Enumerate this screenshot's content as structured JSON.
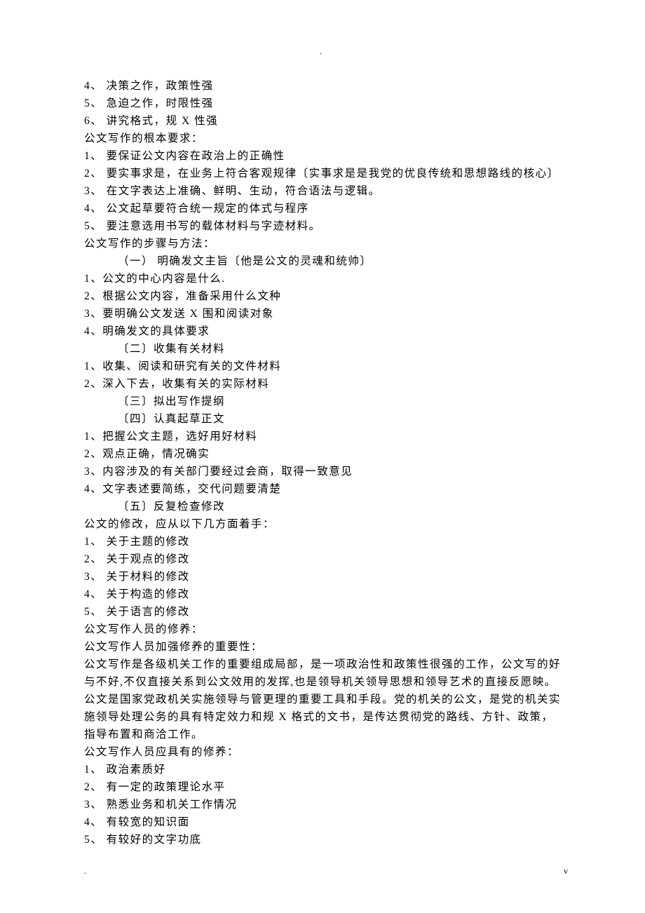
{
  "topMark": ".",
  "lines": [
    {
      "text": "4、 决策之作，政策性强",
      "indent": 0
    },
    {
      "text": "5、 急迫之作，时限性强",
      "indent": 0
    },
    {
      "text": "6、 讲究格式，规 X 性强",
      "indent": 0
    },
    {
      "text": "公文写作的根本要求：",
      "indent": 0
    },
    {
      "text": "1、 要保证公文内容在政治上的正确性",
      "indent": 0
    },
    {
      "text": "2、 要实事求是，在业务上符合客观规律〔实事求是是我党的优良传统和思想路线的核心〕",
      "indent": 0
    },
    {
      "text": "3、 在文字表达上准确、鲜明、生动，符合语法与逻辑。",
      "indent": 0
    },
    {
      "text": "4、 公文起草要符合统一规定的体式与程序",
      "indent": 0
    },
    {
      "text": "5、 要注意选用书写的载体材料与字迹材料。",
      "indent": 0
    },
    {
      "text": "公文写作的步骤与方法：",
      "indent": 0
    },
    {
      "text": "（一） 明确发文主旨〔他是公文的灵魂和统帅〕",
      "indent": 1
    },
    {
      "text": "1、公文的中心内容是什么.",
      "indent": 0
    },
    {
      "text": "2、根据公文内容，准备采用什么文种",
      "indent": 0
    },
    {
      "text": "3、要明确公文发送 X 围和阅读对象",
      "indent": 0
    },
    {
      "text": "4、明确发文的具体要求",
      "indent": 0
    },
    {
      "text": "〔二〕收集有关材料",
      "indent": 1
    },
    {
      "text": "1、收集、阅读和研究有关的文件材料",
      "indent": 0
    },
    {
      "text": "2、深入下去，收集有关的实际材料",
      "indent": 0
    },
    {
      "text": "〔三〕拟出写作提纲",
      "indent": 1
    },
    {
      "text": "〔四〕认真起草正文",
      "indent": 1
    },
    {
      "text": "1、把握公文主题，选好用好材料",
      "indent": 0
    },
    {
      "text": "2、观点正确，情况确实",
      "indent": 0
    },
    {
      "text": "3、内容涉及的有关部门要经过会商，取得一致意见",
      "indent": 0
    },
    {
      "text": "4、文字表述要简练，交代问题要清楚",
      "indent": 0
    },
    {
      "text": "〔五〕反复检查修改",
      "indent": 1
    },
    {
      "text": "公文的修改，应从以下几方面着手：",
      "indent": 0
    },
    {
      "text": "1、 关于主题的修改",
      "indent": 0
    },
    {
      "text": "2、 关于观点的修改",
      "indent": 0
    },
    {
      "text": "3、 关于材料的修改",
      "indent": 0
    },
    {
      "text": "4、 关于构造的修改",
      "indent": 0
    },
    {
      "text": "5、 关于语言的修改",
      "indent": 0
    },
    {
      "text": "公文写作人员的修养：",
      "indent": 0
    },
    {
      "text": "公文写作人员加强修养的重要性：",
      "indent": 0
    },
    {
      "text": "公文写作是各级机关工作的重要组成局部，是一项政治性和政策性很强的工作，公文写的好",
      "indent": 0
    },
    {
      "text": "与不好,不仅直接关系到公文效用的发挥,也是领导机关领导思想和领导艺术的直接反愿映。",
      "indent": 0
    },
    {
      "text": "公文是国家党政机关实施领导与管更理的重要工具和手段。党的机关的公文，是党的机关实",
      "indent": 0
    },
    {
      "text": "施领导处理公务的具有特定效力和规 X 格式的文书，是传达贯彻党的路线、方针、政策，",
      "indent": 0
    },
    {
      "text": "指导布置和商洽工作。",
      "indent": 0
    },
    {
      "text": "公文写作人员应具有的修养：",
      "indent": 0
    },
    {
      "text": "1、 政治素质好",
      "indent": 0
    },
    {
      "text": "2、 有一定的政策理论水平",
      "indent": 0
    },
    {
      "text": "3、 熟悉业务和机关工作情况",
      "indent": 0
    },
    {
      "text": "4、 有较宽的知识面",
      "indent": 0
    },
    {
      "text": "5、 有较好的文字功底",
      "indent": 0
    }
  ],
  "footerLeft": ".",
  "footerRight": "v"
}
